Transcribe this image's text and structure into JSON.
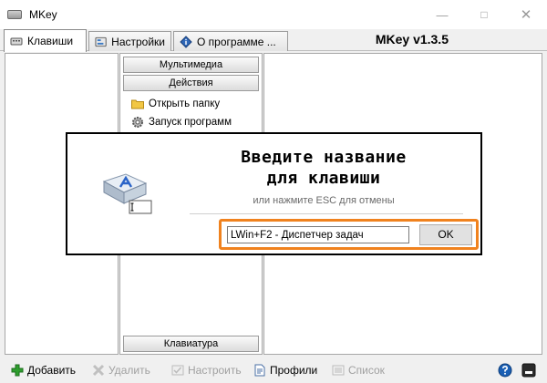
{
  "window": {
    "title": "MKey"
  },
  "tabs": [
    {
      "label": "Клавиши",
      "icon": "keyboard-icon"
    },
    {
      "label": "Настройки",
      "icon": "settings-icon"
    },
    {
      "label": "О программе ...",
      "icon": "info-icon"
    }
  ],
  "version": "MKey v1.3.5",
  "categories": {
    "multimedia": "Мультимедиа",
    "actions": "Действия",
    "keyboard": "Клавиатура"
  },
  "actions_list": [
    {
      "label": "Открыть папку",
      "icon": "folder-icon"
    },
    {
      "label": "Запуск программ",
      "icon": "gear-icon"
    }
  ],
  "dialog": {
    "title_line1": "Введите название",
    "title_line2": "для клавиши",
    "subtitle": "или нажмите ESC для отмены",
    "input_value": "LWin+F2 - Диспетчер задач",
    "ok_label": "OK"
  },
  "toolbar": {
    "add": "Добавить",
    "delete": "Удалить",
    "configure": "Настроить",
    "profiles": "Профили",
    "list": "Список"
  },
  "colors": {
    "highlight": "#f0821e",
    "help": "#1a5fb4",
    "add": "#2e9e2e"
  }
}
